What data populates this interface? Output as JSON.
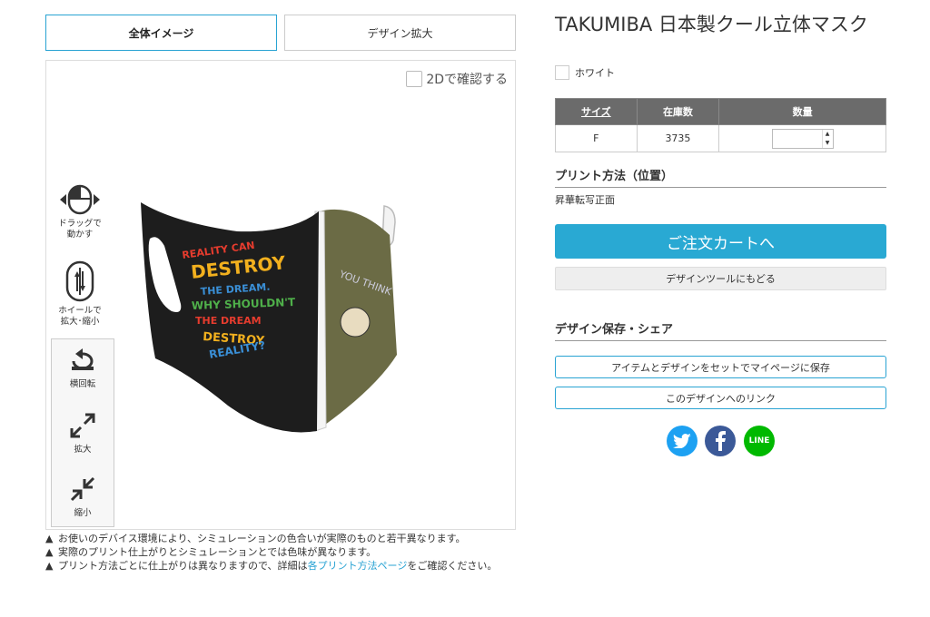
{
  "tabs": [
    {
      "label": "全体イメージ"
    },
    {
      "label": "デザイン拡大"
    }
  ],
  "viewer": {
    "check_2d_label": "2Dで確認する",
    "drag_label": "ドラッグで\n動かす",
    "wheel_label": "ホイールで\n拡大･縮小",
    "rotate_label": "横回転",
    "zoom_in_label": "拡大",
    "zoom_out_label": "縮小",
    "print_text": [
      "REALITY CAN",
      "DESTROY",
      "THE DREAM.",
      "WHY SHOULDN'T",
      "THE DREAM",
      "DESTROY",
      "REALITY?"
    ],
    "print_colors": [
      "#e63c2e",
      "#f2b01e",
      "#3a8fd6",
      "#4fb04a",
      "#e63c2e",
      "#f2b01e",
      "#3a8fd6"
    ]
  },
  "notes": [
    {
      "text": "お使いのデバイス環境により、シミュレーションの色合いが実際のものと若干異なります。"
    },
    {
      "text": "実際のプリント仕上がりとシミュレーションとでは色味が異なります。"
    },
    {
      "pre": "プリント方法ごとに仕上がりは異なりますので、詳細は",
      "link": "各プリント方法ページ",
      "post": "をご確認ください。"
    }
  ],
  "product": {
    "title": "TAKUMIBA 日本製クール立体マスク",
    "color_name": "ホワイト"
  },
  "size_table": {
    "headers": [
      "サイズ",
      "在庫数",
      "数量"
    ],
    "rows": [
      {
        "size": "F",
        "stock": "3735",
        "qty": ""
      }
    ]
  },
  "print_method": {
    "heading": "プリント方法（位置）",
    "value": "昇華転写正面"
  },
  "buttons": {
    "cart": "ご注文カートへ",
    "back": "デザインツールにもどる",
    "save": "アイテムとデザインをセットでマイページに保存",
    "link": "このデザインへのリンク"
  },
  "share_heading": "デザイン保存・シェア",
  "social": [
    {
      "name": "twitter",
      "color": "#1da1f2"
    },
    {
      "name": "facebook",
      "color": "#3b5998"
    },
    {
      "name": "LINE",
      "label": "LINE",
      "color": "#00b900"
    }
  ],
  "colors": {
    "accent": "#29a9d3",
    "mask_black": "#1d1d1d",
    "mask_olive": "#6b6b45"
  }
}
